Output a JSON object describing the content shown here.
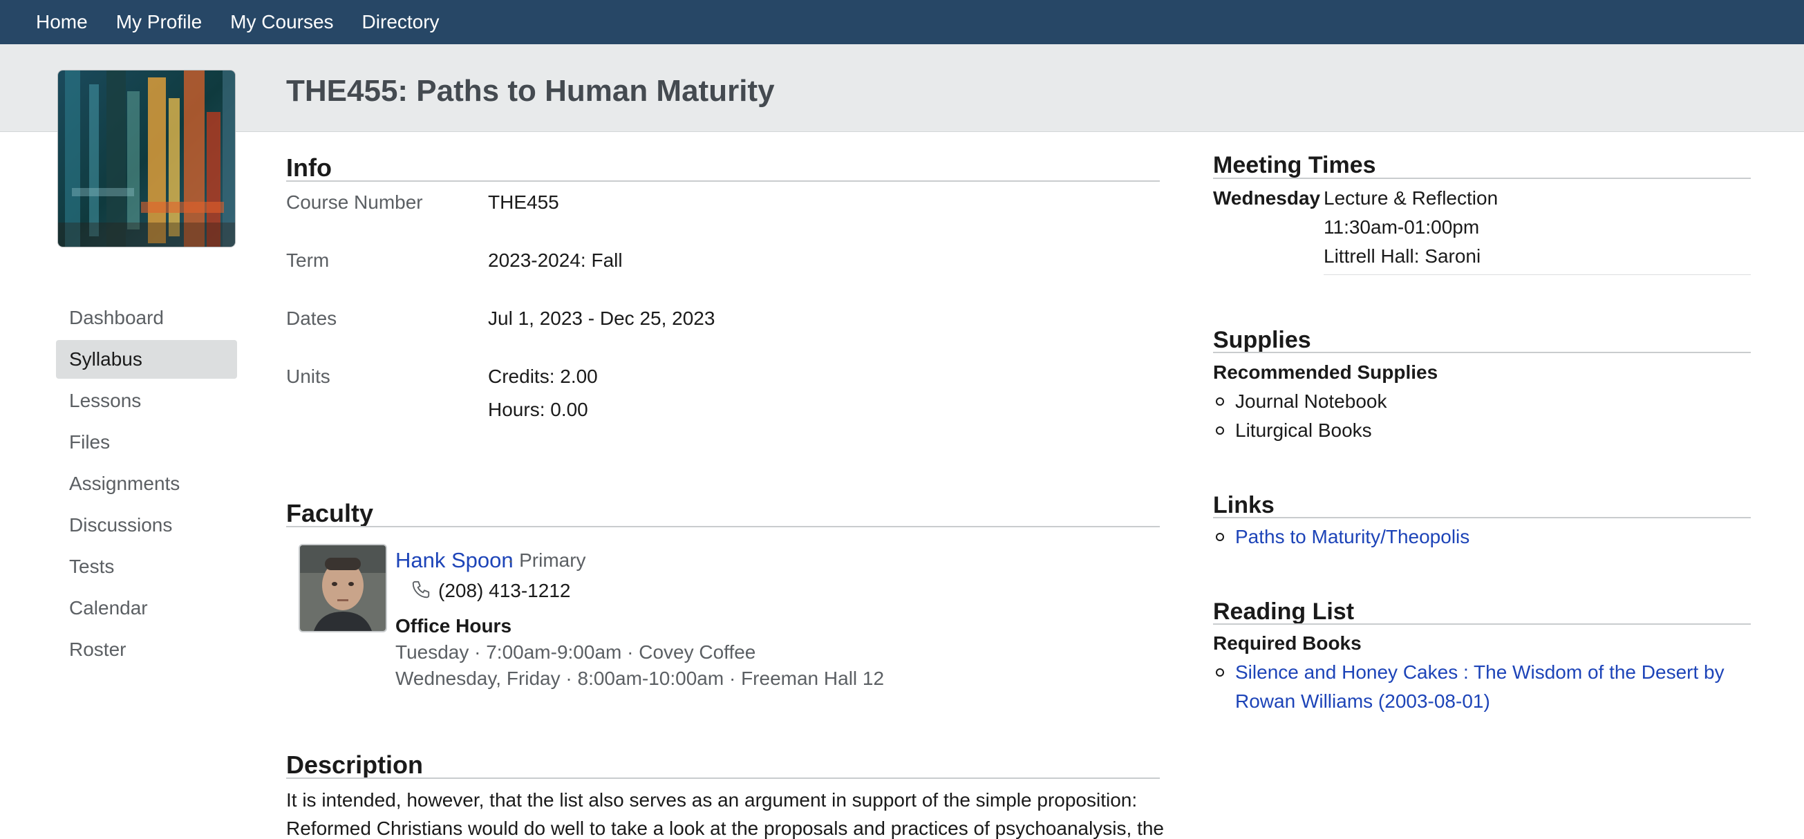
{
  "nav": {
    "items": [
      "Home",
      "My Profile",
      "My Courses",
      "Directory"
    ]
  },
  "page_title": "THE455: Paths to Human Maturity",
  "sidebar": {
    "items": [
      {
        "label": "Dashboard"
      },
      {
        "label": "Syllabus"
      },
      {
        "label": "Lessons"
      },
      {
        "label": "Files"
      },
      {
        "label": "Assignments"
      },
      {
        "label": "Discussions"
      },
      {
        "label": "Tests"
      },
      {
        "label": "Calendar"
      },
      {
        "label": "Roster"
      }
    ],
    "active": "Syllabus"
  },
  "info": {
    "title": "Info",
    "course_number_label": "Course Number",
    "course_number": "THE455",
    "term_label": "Term",
    "term": "2023-2024: Fall",
    "dates_label": "Dates",
    "dates": "Jul 1, 2023 - Dec 25, 2023",
    "units_label": "Units",
    "credits": "Credits: 2.00",
    "hours": "Hours: 0.00"
  },
  "faculty": {
    "title": "Faculty",
    "name": "Hank Spoon",
    "role": "· Primary",
    "phone": "(208) 413-1212",
    "office_hours_title": "Office Hours",
    "office_hours": [
      "Tuesday · 7:00am-9:00am · Covey Coffee",
      "Wednesday, Friday · 8:00am-10:00am · Freeman Hall 12"
    ]
  },
  "description": {
    "title": "Description",
    "text": "It is intended, however, that the list also serves as an argument in support of the simple proposition: Reformed Christians would do well to take a look at the proposals and practices of psychoanalysis, the"
  },
  "meeting_times": {
    "title": "Meeting Times",
    "day": "Wednesday",
    "activity": "Lecture & Reflection",
    "time": "11:30am-01:00pm",
    "location": "Littrell Hall: Saroni"
  },
  "supplies": {
    "title": "Supplies",
    "subtitle": "Recommended Supplies",
    "items": [
      "Journal Notebook",
      "Liturgical Books"
    ]
  },
  "links": {
    "title": "Links",
    "items": [
      "Paths to Maturity/Theopolis"
    ]
  },
  "reading_list": {
    "title": "Reading List",
    "subtitle": "Required Books",
    "book_line1": "Silence and Honey Cakes : The Wisdom of the Desert by",
    "book_line2": "Rowan Williams (2003-08-01)"
  },
  "colors": {
    "nav_bg": "#274766",
    "band_bg": "#e8eaeb",
    "link": "#1d44b8"
  }
}
